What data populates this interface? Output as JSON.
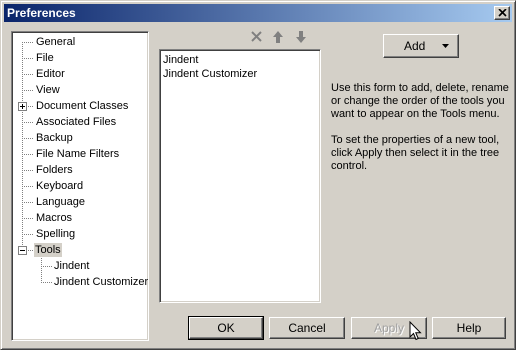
{
  "window": {
    "title": "Preferences"
  },
  "tree": {
    "items": [
      {
        "label": "General"
      },
      {
        "label": "File"
      },
      {
        "label": "Editor"
      },
      {
        "label": "View"
      },
      {
        "label": "Document Classes"
      },
      {
        "label": "Associated Files"
      },
      {
        "label": "Backup"
      },
      {
        "label": "File Name Filters"
      },
      {
        "label": "Folders"
      },
      {
        "label": "Keyboard"
      },
      {
        "label": "Language"
      },
      {
        "label": "Macros"
      },
      {
        "label": "Spelling"
      },
      {
        "label": "Tools"
      },
      {
        "label": "Jindent"
      },
      {
        "label": "Jindent Customizer"
      }
    ],
    "selected": "Tools"
  },
  "tools_list": {
    "items": [
      "Jindent",
      "Jindent Customizer"
    ],
    "toolbar_icons": [
      "delete-icon",
      "move-up-icon",
      "move-down-icon"
    ]
  },
  "add_button": {
    "label": "Add"
  },
  "info": {
    "paragraph1": "Use this form to add, delete, rename or change the order of the tools you want to appear on the Tools menu.",
    "paragraph2": "To set the properties of a new tool, click Apply then select it in the tree control."
  },
  "buttons": {
    "ok": "OK",
    "cancel": "Cancel",
    "apply": "Apply",
    "help": "Help"
  },
  "colors": {
    "title_bar_start": "#0a246a",
    "title_bar_end": "#a6caf0",
    "face": "#d4d0c8",
    "disabled_text": "#a0a0a0"
  }
}
